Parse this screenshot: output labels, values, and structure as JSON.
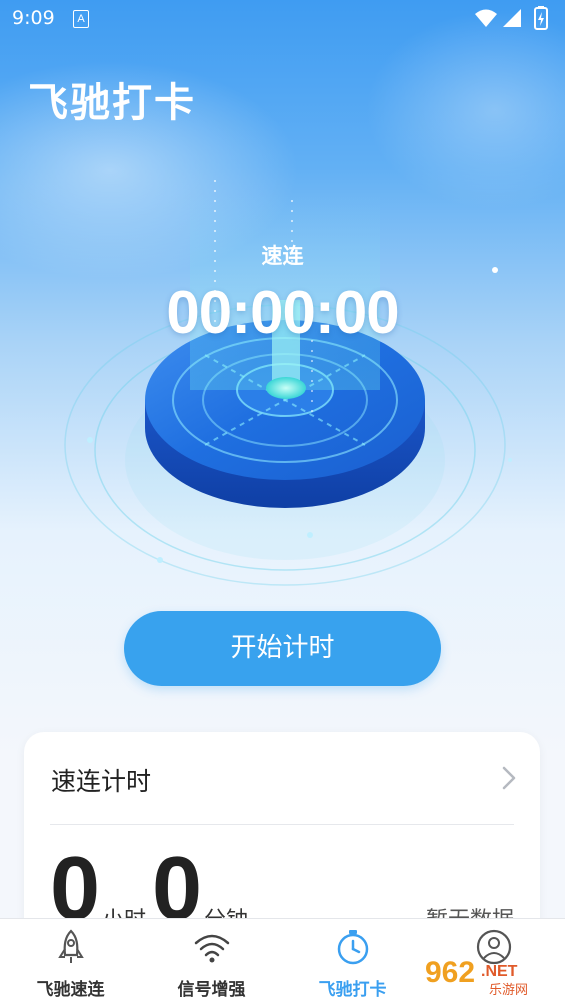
{
  "status_bar": {
    "time": "9:09",
    "notification_letter": "A"
  },
  "header": {
    "title": "飞驰打卡"
  },
  "timer": {
    "label": "速连",
    "value": "00:00:00"
  },
  "start_button": {
    "label": "开始计时"
  },
  "record_card": {
    "title": "速连计时",
    "hours_value": "0",
    "hours_unit": "小时",
    "minutes_value": "0",
    "minutes_unit": "分钟",
    "empty_text": "暂无数据"
  },
  "tabbar": {
    "items": [
      {
        "label": "飞驰速连",
        "icon": "rocket-icon"
      },
      {
        "label": "信号增强",
        "icon": "wifi-icon"
      },
      {
        "label": "飞驰打卡",
        "icon": "stopwatch-icon",
        "active": true
      },
      {
        "label": "",
        "icon": "user-icon"
      }
    ]
  },
  "watermark": {
    "text": "962",
    "suffix": ".NET",
    "sub": "乐游网"
  },
  "colors": {
    "accent": "#38a2ee",
    "active_tab": "#3a9ff0",
    "hero_top": "#3f9cf2"
  }
}
